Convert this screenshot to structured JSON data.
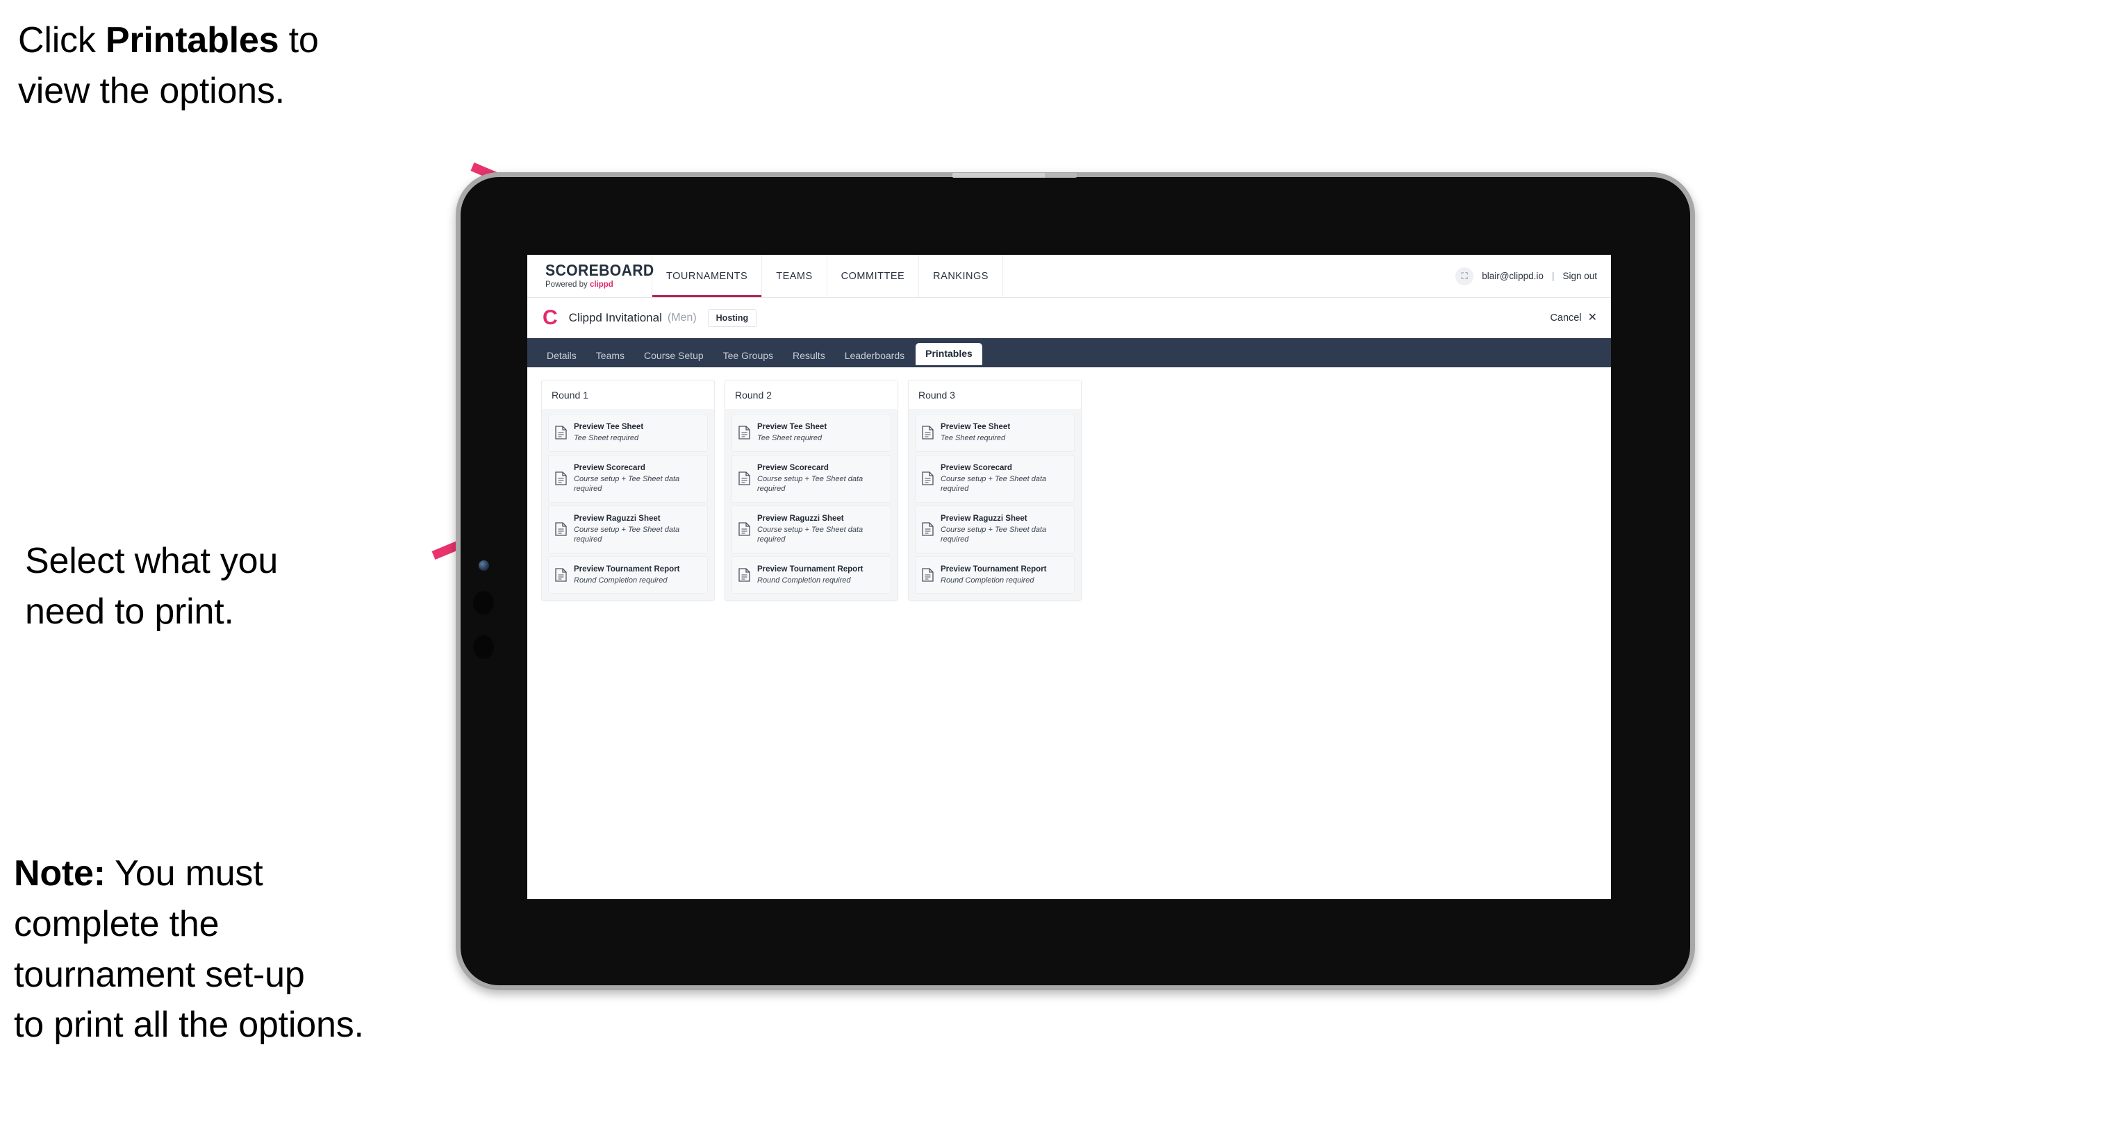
{
  "annotations": {
    "click_printables": {
      "prefix": "Click ",
      "bold": "Printables",
      "suffix": " to\nview the options."
    },
    "select_print": "Select what you\n need to print.",
    "note": {
      "bold": "Note:",
      "rest": " You must\ncomplete the\ntournament set-up\nto print all the options."
    }
  },
  "app": {
    "brand": {
      "word": "SCOREBOARD",
      "powered_prefix": "Powered by ",
      "powered_brand": "clippd"
    },
    "main_nav": [
      {
        "label": "TOURNAMENTS",
        "active": true
      },
      {
        "label": "TEAMS",
        "active": false
      },
      {
        "label": "COMMITTEE",
        "active": false
      },
      {
        "label": "RANKINGS",
        "active": false
      }
    ],
    "account": {
      "avatar_glyph": "⛶",
      "email": "blair@clippd.io",
      "separator": "|",
      "sign_out": "Sign out"
    },
    "tournament": {
      "logo_letter": "C",
      "name": "Clippd Invitational",
      "gender": "(Men)",
      "badge": "Hosting",
      "cancel_label": "Cancel",
      "cancel_icon": "✕"
    },
    "tabs": [
      {
        "label": "Details",
        "active": false
      },
      {
        "label": "Teams",
        "active": false
      },
      {
        "label": "Course Setup",
        "active": false
      },
      {
        "label": "Tee Groups",
        "active": false
      },
      {
        "label": "Results",
        "active": false
      },
      {
        "label": "Leaderboards",
        "active": false
      },
      {
        "label": "Printables",
        "active": true
      }
    ],
    "rounds": [
      {
        "title": "Round 1",
        "items": [
          {
            "title": "Preview Tee Sheet",
            "requirement": "Tee Sheet required"
          },
          {
            "title": "Preview Scorecard",
            "requirement": "Course setup + Tee Sheet data required"
          },
          {
            "title": "Preview Raguzzi Sheet",
            "requirement": "Course setup + Tee Sheet data required"
          },
          {
            "title": "Preview Tournament Report",
            "requirement": "Round Completion required"
          }
        ]
      },
      {
        "title": "Round 2",
        "items": [
          {
            "title": "Preview Tee Sheet",
            "requirement": "Tee Sheet required"
          },
          {
            "title": "Preview Scorecard",
            "requirement": "Course setup + Tee Sheet data required"
          },
          {
            "title": "Preview Raguzzi Sheet",
            "requirement": "Course setup + Tee Sheet data required"
          },
          {
            "title": "Preview Tournament Report",
            "requirement": "Round Completion required"
          }
        ]
      },
      {
        "title": "Round 3",
        "items": [
          {
            "title": "Preview Tee Sheet",
            "requirement": "Tee Sheet required"
          },
          {
            "title": "Preview Scorecard",
            "requirement": "Course setup + Tee Sheet data required"
          },
          {
            "title": "Preview Raguzzi Sheet",
            "requirement": "Course setup + Tee Sheet data required"
          },
          {
            "title": "Preview Tournament Report",
            "requirement": "Round Completion required"
          }
        ]
      }
    ]
  },
  "colors": {
    "accent_pink": "#e8336d",
    "brand_pink": "#e3286b",
    "tabstrip_navy": "#2f3b50",
    "active_underline": "#b0274f",
    "bezel_gray": "#a8a8a8",
    "bezel_black": "#0d0d0d"
  }
}
